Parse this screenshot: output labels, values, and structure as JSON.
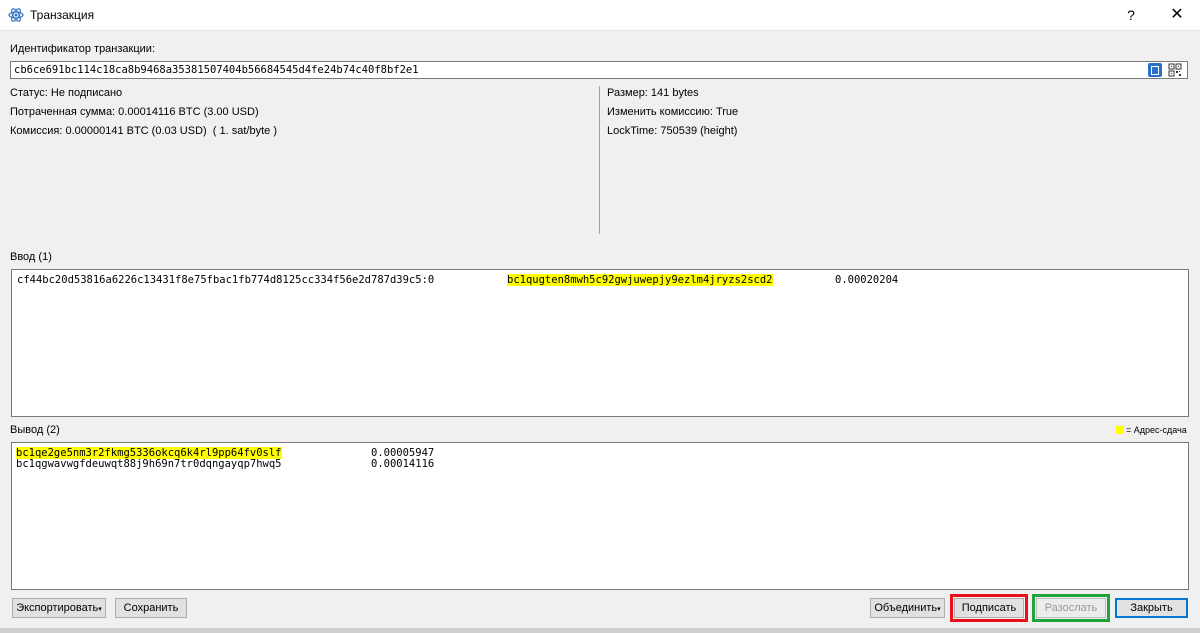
{
  "window": {
    "title": "Транзакция",
    "help": "?",
    "close": "✕"
  },
  "txid": {
    "label": "Идентификатор транзакции:",
    "value": "cb6ce691bc114c18ca8b9468a35381507404b56684545d4fe24b74c40f8bf2e1"
  },
  "details_left": [
    "Статус: Не подписано",
    "Потраченная сумма: 0.00014116 BTC (3.00 USD)",
    "Комиссия: 0.00000141 BTC (0.03 USD)  ( 1. sat/byte )"
  ],
  "details_right": [
    "Размер: 141 bytes",
    "Изменить комиссию: True",
    "LockTime: 750539 (height)"
  ],
  "inputs": {
    "label": "Ввод (1)",
    "rows": [
      {
        "outpoint": "cf44bc20d53816a6226c13431f8e75fbac1fb774d8125cc334f56e2d787d39c5:0",
        "address": "bc1qugten8mwh5c92gwjuwepjy9ezlm4jryzs2scd2",
        "amount": "0.00020204"
      }
    ]
  },
  "outputs": {
    "label": "Вывод (2)",
    "legend": "= Адрес-сдача",
    "rows": [
      {
        "address": "bc1qe2ge5nm3r2fkmg5336okcq6k4rl9pp64fv0slf",
        "amount": "0.00005947",
        "change": true
      },
      {
        "address": "bc1qgwavwgfdeuwqt88j9h69n7tr0dqngayqp7hwq5",
        "amount": "0.00014116",
        "change": false
      }
    ]
  },
  "buttons": {
    "export": "Экспортировать",
    "save": "Сохранить",
    "combine": "Объединить",
    "sign": "Подписать",
    "broadcast": "Разослать",
    "close": "Закрыть"
  },
  "colors": {
    "change_highlight": "#ffff00",
    "sign_outline": "#e8101a",
    "broadcast_outline": "#1fa33a",
    "primary": "#0078d7"
  }
}
